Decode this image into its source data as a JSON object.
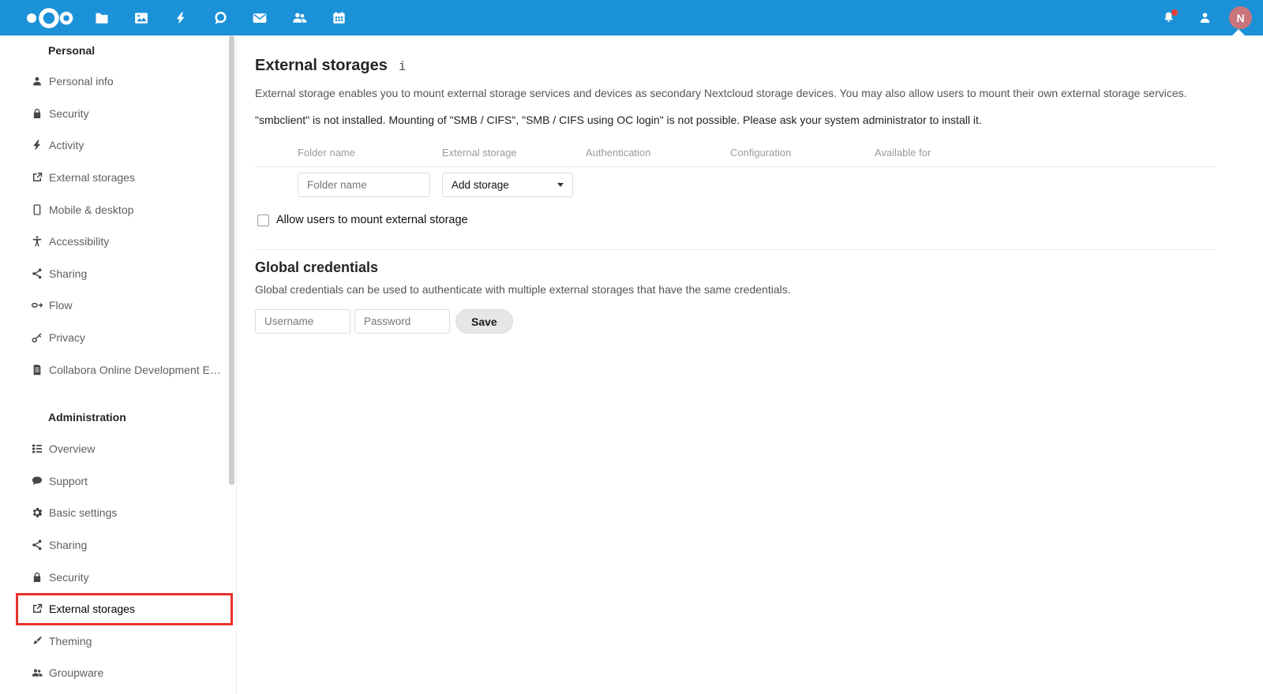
{
  "header": {
    "bg_color": "#1b91d8",
    "apps": [
      {
        "name": "files",
        "icon": "folder-icon"
      },
      {
        "name": "photos",
        "icon": "image-icon"
      },
      {
        "name": "activity",
        "icon": "bolt-icon"
      },
      {
        "name": "talk",
        "icon": "chat-bubble-icon"
      },
      {
        "name": "mail",
        "icon": "envelope-icon"
      },
      {
        "name": "contacts",
        "icon": "people-icon"
      },
      {
        "name": "calendar",
        "icon": "calendar-icon"
      }
    ],
    "notifications_icon": "bell-icon",
    "notification_dot_color": "#eb3f34",
    "contacts_menu_icon": "person-icon",
    "avatar": {
      "initial": "N",
      "color": "#c9757c"
    }
  },
  "sidebar": {
    "sections": [
      {
        "label": "Personal",
        "items": [
          {
            "label": "Personal info",
            "icon": "user-icon"
          },
          {
            "label": "Security",
            "icon": "lock-icon"
          },
          {
            "label": "Activity",
            "icon": "bolt-icon"
          },
          {
            "label": "External storages",
            "icon": "external-link-icon"
          },
          {
            "label": "Mobile & desktop",
            "icon": "phone-icon"
          },
          {
            "label": "Accessibility",
            "icon": "accessibility-icon"
          },
          {
            "label": "Sharing",
            "icon": "share-icon"
          },
          {
            "label": "Flow",
            "icon": "flow-icon"
          },
          {
            "label": "Privacy",
            "icon": "key-icon"
          },
          {
            "label": "Collabora Online Development Edit...",
            "icon": "document-icon"
          }
        ]
      },
      {
        "label": "Administration",
        "items": [
          {
            "label": "Overview",
            "icon": "overview-list-icon"
          },
          {
            "label": "Support",
            "icon": "speech-bubble-icon"
          },
          {
            "label": "Basic settings",
            "icon": "gear-icon"
          },
          {
            "label": "Sharing",
            "icon": "share-icon"
          },
          {
            "label": "Security",
            "icon": "lock-icon"
          },
          {
            "label": "External storages",
            "icon": "external-link-icon",
            "highlighted": true
          },
          {
            "label": "Theming",
            "icon": "brush-icon"
          },
          {
            "label": "Groupware",
            "icon": "group-icon"
          }
        ]
      }
    ],
    "highlight_color": "#e9322d"
  },
  "main": {
    "title": "External storages",
    "info_icon": "i",
    "description": "External storage enables you to mount external storage services and devices as secondary Nextcloud storage devices. You may also allow users to mount their own external storage services.",
    "warning": "\"smbclient\" is not installed. Mounting of \"SMB / CIFS\", \"SMB / CIFS using OC login\" is not possible. Please ask your system administrator to install it.",
    "table": {
      "headers": {
        "folder_name": "Folder name",
        "external_storage": "External storage",
        "authentication": "Authentication",
        "configuration": "Configuration",
        "available_for": "Available for"
      }
    },
    "folder_name_placeholder": "Folder name",
    "add_storage_label": "Add storage",
    "allow_users_label": "Allow users to mount external storage",
    "allow_users_checked": false,
    "global_credentials": {
      "title": "Global credentials",
      "description": "Global credentials can be used to authenticate with multiple external storages that have the same credentials.",
      "username_placeholder": "Username",
      "password_placeholder": "Password",
      "save_label": "Save"
    }
  }
}
